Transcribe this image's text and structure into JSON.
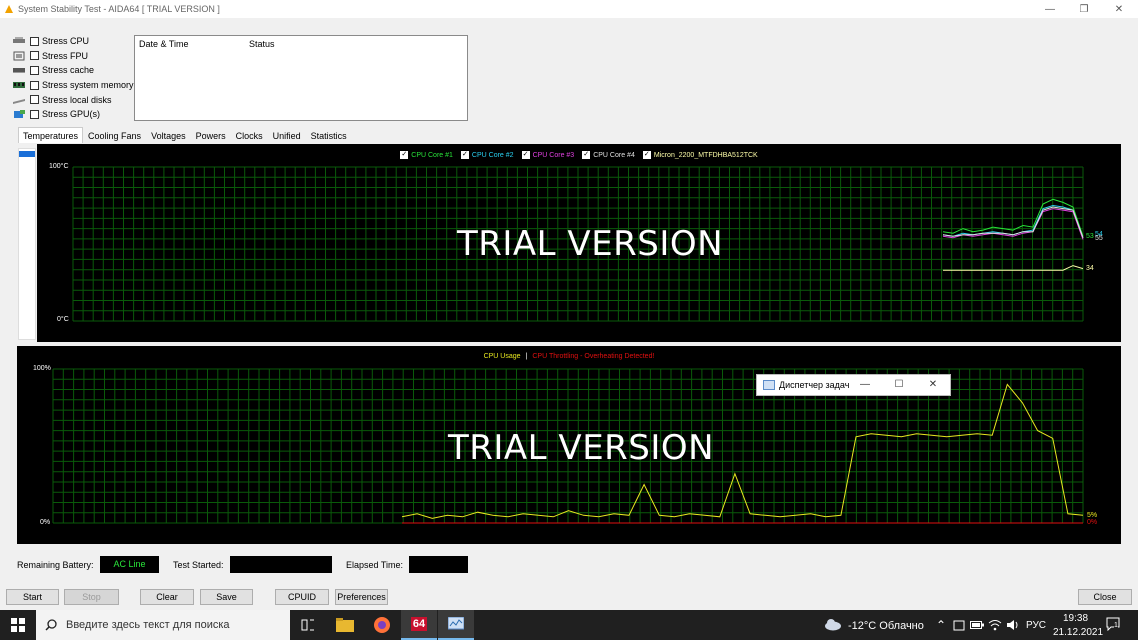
{
  "window": {
    "title": "System Stability Test - AIDA64  [ TRIAL VERSION ]",
    "minimize_glyph": "—",
    "maximize_glyph": "❐",
    "close_glyph": "✕"
  },
  "stress": {
    "items": [
      {
        "label": "Stress CPU",
        "icon": "cpu-icon",
        "checked": false
      },
      {
        "label": "Stress FPU",
        "icon": "fpu-icon",
        "checked": false
      },
      {
        "label": "Stress cache",
        "icon": "cache-icon",
        "checked": false
      },
      {
        "label": "Stress system memory",
        "icon": "memory-icon",
        "checked": false
      },
      {
        "label": "Stress local disks",
        "icon": "disk-icon",
        "checked": false
      },
      {
        "label": "Stress GPU(s)",
        "icon": "gpu-icon",
        "checked": false
      }
    ]
  },
  "log": {
    "columns": [
      "Date & Time",
      "Status"
    ]
  },
  "tabs": [
    "Temperatures",
    "Cooling Fans",
    "Voltages",
    "Powers",
    "Clocks",
    "Unified",
    "Statistics"
  ],
  "temp_chart": {
    "legend": [
      {
        "label": "CPU Core #1",
        "color": "#29e43a"
      },
      {
        "label": "CPU Core #2",
        "color": "#2ad0f0"
      },
      {
        "label": "CPU Core #3",
        "color": "#e040e0"
      },
      {
        "label": "CPU Core #4",
        "color": "#e0e0e0"
      },
      {
        "label": "Micron_2200_MTFDHBA512TCK",
        "color": "#ffffaa"
      }
    ],
    "y_top": "100°C",
    "y_bottom": "0°C",
    "watermark": "TRIAL VERSION",
    "value_labels": {
      "cores_a": "53",
      "cores_b": "54",
      "cores_c": "55",
      "disk": "34"
    },
    "grid_color": "#0a5a0a"
  },
  "usage_chart": {
    "legend_usage": "CPU Usage",
    "legend_sep": "|",
    "legend_throttle": "CPU Throttling - Overheating Detected!",
    "usage_color": "#e8e820",
    "throttle_color": "#e01010",
    "y_top": "100%",
    "y_bottom": "0%",
    "watermark": "TRIAL VERSION",
    "value_labels": {
      "usage": "5%",
      "throttle": "0%"
    }
  },
  "chart_data": [
    {
      "type": "line",
      "title": "",
      "ylim": [
        0,
        100
      ],
      "ylabel": "°C",
      "series": [
        {
          "name": "CPU Core #1",
          "values": [
            58,
            57,
            60,
            58,
            59,
            61,
            60,
            59,
            62,
            61,
            76,
            79,
            77,
            74,
            55
          ]
        },
        {
          "name": "CPU Core #2",
          "values": [
            56,
            55,
            57,
            56,
            57,
            58,
            57,
            56,
            58,
            59,
            73,
            75,
            74,
            72,
            54
          ]
        },
        {
          "name": "CPU Core #3",
          "values": [
            55,
            54,
            56,
            55,
            56,
            57,
            56,
            55,
            57,
            58,
            71,
            73,
            72,
            71,
            53
          ]
        },
        {
          "name": "CPU Core #4",
          "values": [
            56,
            55,
            56,
            56,
            57,
            57,
            57,
            56,
            58,
            58,
            72,
            74,
            73,
            72,
            54
          ]
        },
        {
          "name": "Micron_2200_MTFDHBA512TCK",
          "values": [
            33,
            33,
            33,
            33,
            33,
            33,
            33,
            33,
            33,
            33,
            33,
            33,
            33,
            36,
            34
          ]
        }
      ]
    },
    {
      "type": "line",
      "title": "",
      "ylim": [
        0,
        100
      ],
      "series": [
        {
          "name": "CPU Usage",
          "values": [
            4,
            6,
            3,
            5,
            4,
            7,
            5,
            4,
            6,
            5,
            4,
            8,
            5,
            4,
            6,
            5,
            25,
            5,
            4,
            6,
            5,
            4,
            32,
            6,
            5,
            4,
            5,
            6,
            4,
            5,
            56,
            58,
            57,
            56,
            58,
            57,
            56,
            57,
            58,
            57,
            90,
            78,
            60,
            55,
            6,
            5
          ]
        },
        {
          "name": "CPU Throttling",
          "values": [
            0,
            0,
            0,
            0,
            0,
            0,
            0,
            0,
            0,
            0,
            0,
            0,
            0,
            0,
            0,
            0,
            0,
            0,
            0,
            0,
            0,
            0,
            0,
            0,
            0,
            0,
            0,
            0,
            0,
            0,
            0,
            0,
            0,
            0,
            0,
            0,
            0,
            0,
            0,
            0,
            0,
            0,
            0,
            0,
            0,
            0
          ]
        }
      ]
    }
  ],
  "popup": {
    "title": "Диспетчер задач",
    "minimize_glyph": "—",
    "maximize_glyph": "☐",
    "close_glyph": "✕"
  },
  "status": {
    "battery_label": "Remaining Battery:",
    "battery_value": "AC Line",
    "started_label": "Test Started:",
    "started_value": "",
    "elapsed_label": "Elapsed Time:",
    "elapsed_value": ""
  },
  "buttons": {
    "start": "Start",
    "stop": "Stop",
    "clear": "Clear",
    "save": "Save",
    "cpuid": "CPUID",
    "preferences": "Preferences",
    "close": "Close"
  },
  "taskbar": {
    "search_placeholder": "Введите здесь текст для поиска",
    "weather": "-12°C  Облачно",
    "lang": "РУС",
    "time": "19:38",
    "date": "21.12.2021",
    "notification_count": "1",
    "aida_label": "64"
  }
}
